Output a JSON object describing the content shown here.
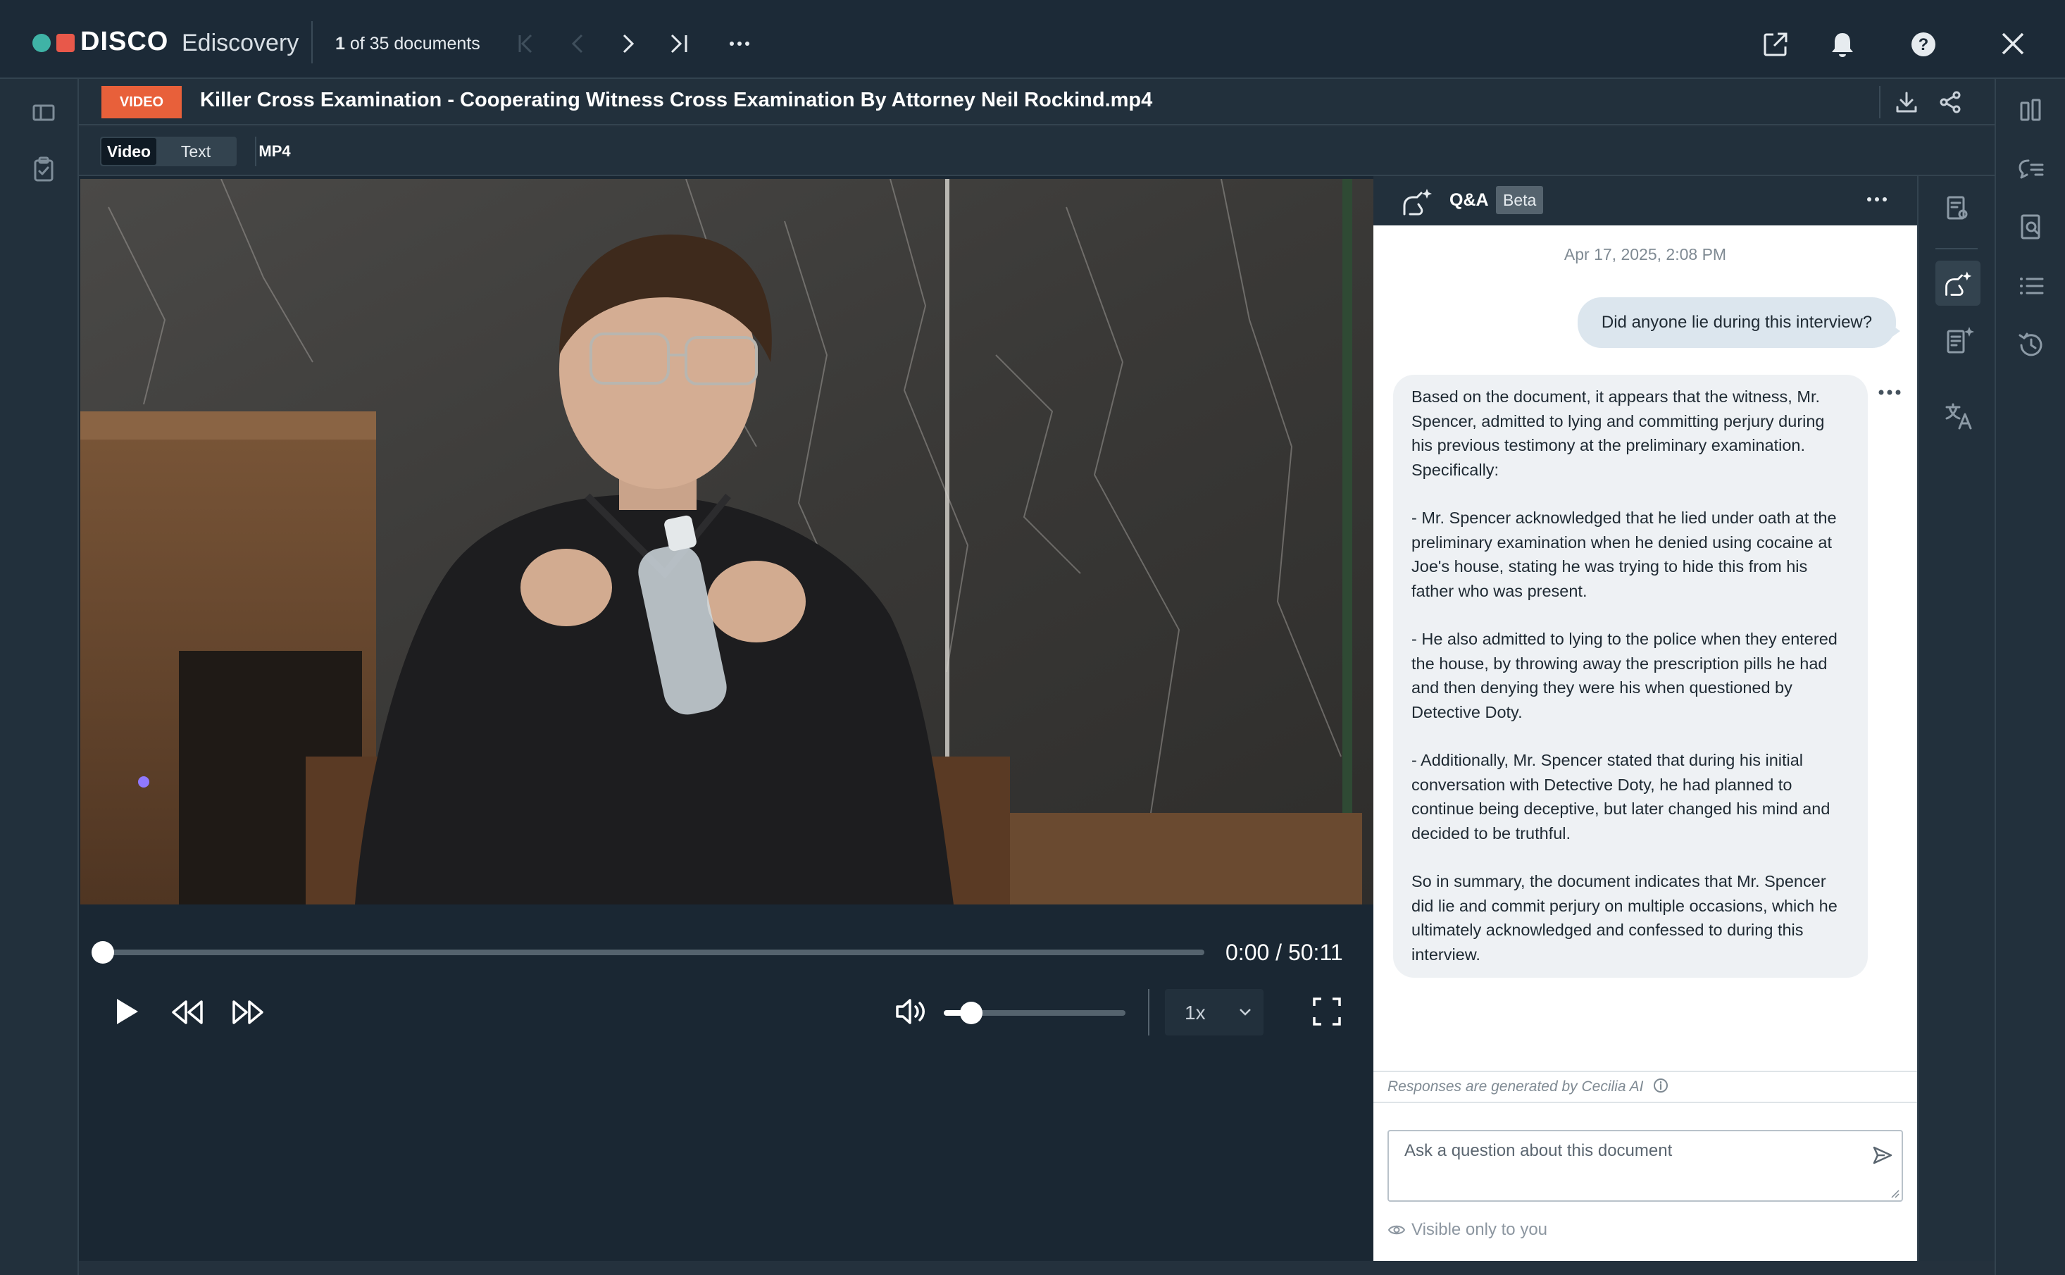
{
  "app": {
    "brand_disco": "DISCO",
    "brand_sub": "Ediscovery"
  },
  "nav": {
    "count_strong": "1",
    "count_rest": " of 35 documents"
  },
  "doc": {
    "type_badge": "VIDEO",
    "title": "Killer Cross Examination - Cooperating Witness Cross Examination By Attorney Neil Rockind.mp4"
  },
  "tabs": {
    "video": "Video",
    "text": "Text",
    "format": "MP4"
  },
  "player": {
    "time": "0:00 / 50:11",
    "speed": "1x",
    "progress_fraction": 0,
    "volume_fraction": 0.15
  },
  "qa": {
    "title": "Q&A",
    "beta": "Beta",
    "timestamp": "Apr 17, 2025, 2:08 PM",
    "user_message": "Did anyone lie during this interview?",
    "ai_paragraphs": [
      "Based on the document, it appears that the witness, Mr. Spencer, admitted to lying and committing perjury during his previous testimony at the preliminary examination. Specifically:",
      "- Mr. Spencer acknowledged that he lied under oath at the preliminary examination when he denied using cocaine at Joe's house, stating he was trying to hide this from his father who was present.",
      "- He also admitted to lying to the police when they entered the house, by throwing away the prescription pills he had and then denying they were his when questioned by Detective Doty.",
      "- Additionally, Mr. Spencer stated that during his initial conversation with Detective Doty, he had planned to continue being deceptive, but later changed his mind and decided to be truthful.",
      "So in summary, the document indicates that Mr. Spencer did lie and commit perjury on multiple occasions, which he ultimately acknowledged and confessed to during this interview."
    ],
    "disclaimer": "Responses are generated by Cecilia AI",
    "input_placeholder": "Ask a question about this document",
    "visibility": "Visible only to you"
  },
  "colors": {
    "accent_teal": "#3fb3a6",
    "accent_red": "#e8584a",
    "badge_orange": "#e8603a"
  }
}
